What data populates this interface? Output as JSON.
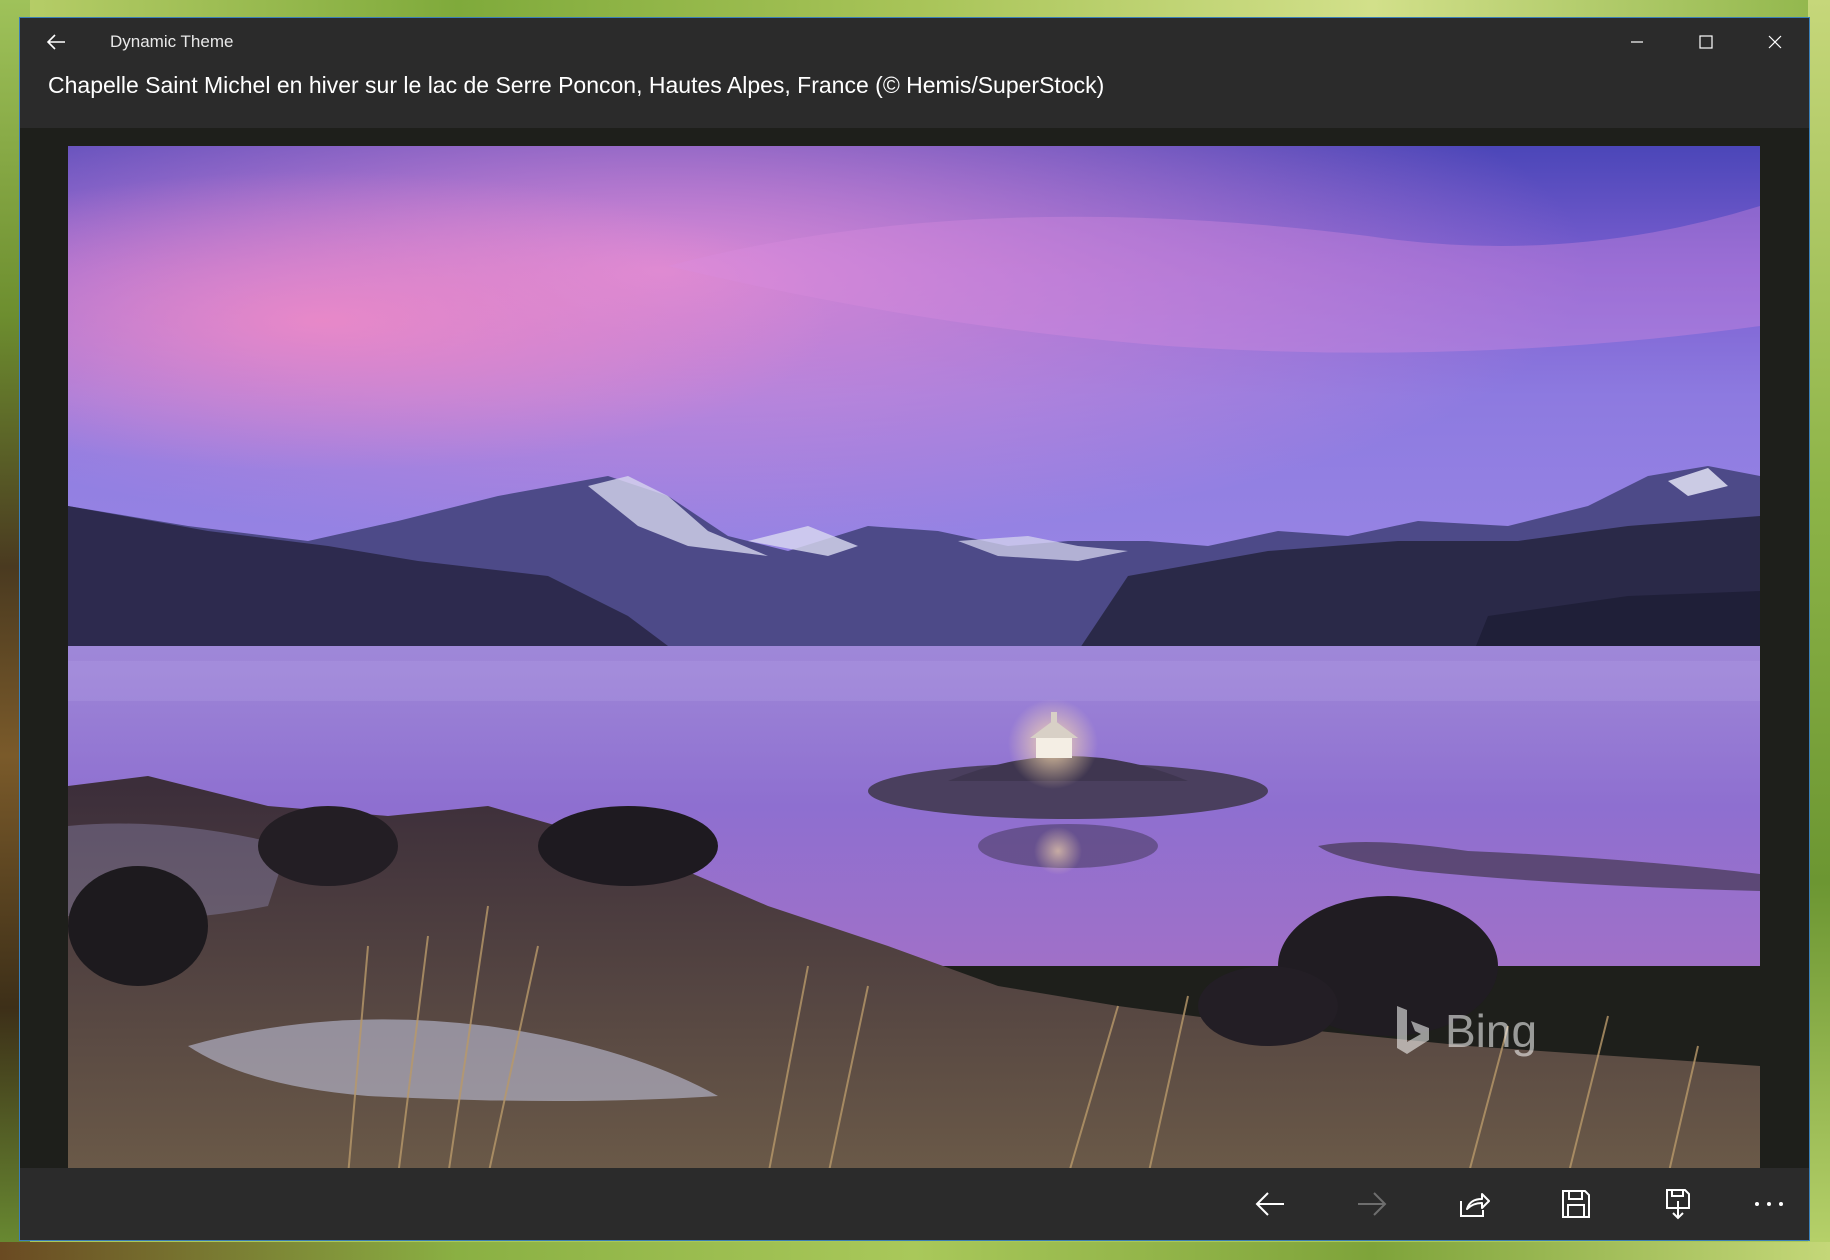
{
  "window": {
    "title": "Dynamic Theme",
    "caption": "Chapelle Saint Michel en hiver sur le lac de Serre Poncon, Hautes Alpes, France (© Hemis/SuperStock)",
    "accent_border": "#3a7fb8"
  },
  "titlebar": {
    "back_icon": "back-arrow-icon",
    "minimize_icon": "minimize-icon",
    "maximize_icon": "maximize-icon",
    "close_icon": "close-icon"
  },
  "photo": {
    "watermark": "Bing",
    "subject": "lake with small island chapel at dusk",
    "sky_colors": [
      "#5a4fc4",
      "#c77fd6",
      "#8a7ad8"
    ],
    "water_color": "#9a7fd6"
  },
  "commandbar": {
    "buttons": [
      {
        "icon": "previous-arrow-icon",
        "enabled": true
      },
      {
        "icon": "next-arrow-icon",
        "enabled": false
      },
      {
        "icon": "share-icon",
        "enabled": true
      },
      {
        "icon": "save-icon",
        "enabled": true
      },
      {
        "icon": "save-as-icon",
        "enabled": true
      },
      {
        "icon": "more-icon",
        "enabled": true
      }
    ]
  }
}
